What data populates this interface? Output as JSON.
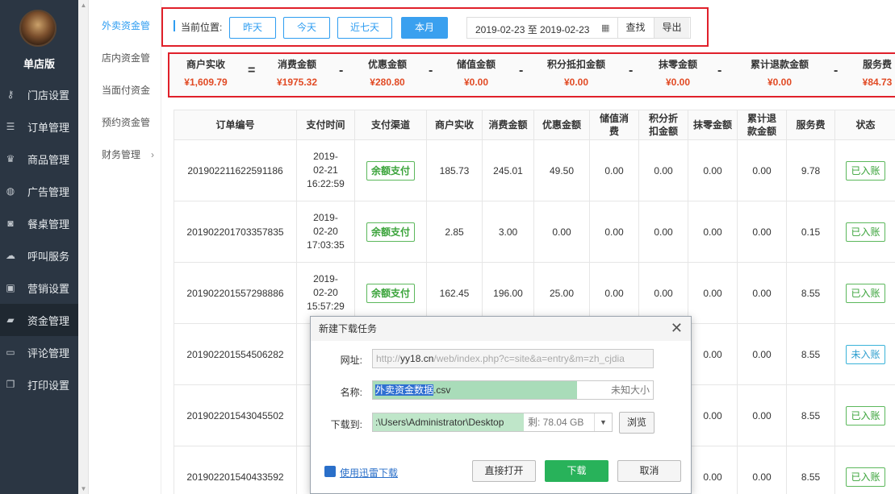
{
  "sidebar": {
    "shop_name": "单店版",
    "items": [
      {
        "label": "门店设置",
        "icon": "key-icon"
      },
      {
        "label": "订单管理",
        "icon": "list-icon"
      },
      {
        "label": "商品管理",
        "icon": "trophy-icon"
      },
      {
        "label": "广告管理",
        "icon": "globe-icon"
      },
      {
        "label": "餐桌管理",
        "icon": "binoculars-icon"
      },
      {
        "label": "呼叫服务",
        "icon": "cloud-icon"
      },
      {
        "label": "营销设置",
        "icon": "gift-icon"
      },
      {
        "label": "资金管理",
        "icon": "book-icon",
        "active": true
      },
      {
        "label": "评论管理",
        "icon": "money-icon"
      },
      {
        "label": "打印设置",
        "icon": "copy-icon"
      }
    ]
  },
  "subnav": {
    "items": [
      {
        "label": "外卖资金管",
        "active": true
      },
      {
        "label": "店内资金管"
      },
      {
        "label": "当面付资金"
      },
      {
        "label": "预约资金管"
      },
      {
        "label": "财务管理"
      }
    ],
    "chevron": "›"
  },
  "toolbar": {
    "location_label": "当前位置:",
    "buttons": [
      "昨天",
      "今天",
      "近七天",
      "本月"
    ],
    "date_range": "2019-02-23 至 2019-02-23",
    "search_label": "查找",
    "export_label": "导出"
  },
  "summary": {
    "items": [
      {
        "label": "商户实收",
        "value": "¥1,609.79"
      },
      {
        "label": "消费金额",
        "value": "¥1975.32"
      },
      {
        "label": "优惠金额",
        "value": "¥280.80"
      },
      {
        "label": "储值金额",
        "value": "¥0.00"
      },
      {
        "label": "积分抵扣金额",
        "value": "¥0.00"
      },
      {
        "label": "抹零金额",
        "value": "¥0.00"
      },
      {
        "label": "累计退款金额",
        "value": "¥0.00"
      },
      {
        "label": "服务费",
        "value": "¥84.73"
      }
    ],
    "operators": [
      "=",
      "-",
      "-",
      "-",
      "-",
      "-",
      "-"
    ]
  },
  "table": {
    "headers": [
      "订单编号",
      "支付时间",
      "支付渠道",
      "商户实收",
      "消费金额",
      "优惠金额",
      "储值消费",
      "积分折扣金额",
      "抹零金额",
      "累计退款金额",
      "服务费",
      "状态"
    ],
    "rows": [
      {
        "order": "201902211622591186",
        "time": [
          "2019-",
          "02-21",
          "16:22:59"
        ],
        "channel": "余额支付",
        "received": "185.73",
        "consume": "245.01",
        "discount": "49.50",
        "stored": "0.00",
        "points": "0.00",
        "rounding": "0.00",
        "refund": "0.00",
        "fee": "9.78",
        "status": "已入账",
        "status_color": "green"
      },
      {
        "order": "201902201703357835",
        "time": [
          "2019-",
          "02-20",
          "17:03:35"
        ],
        "channel": "余额支付",
        "received": "2.85",
        "consume": "3.00",
        "discount": "0.00",
        "stored": "0.00",
        "points": "0.00",
        "rounding": "0.00",
        "refund": "0.00",
        "fee": "0.15",
        "status": "已入账",
        "status_color": "green"
      },
      {
        "order": "201902201557298886",
        "time": [
          "2019-",
          "02-20",
          "15:57:29"
        ],
        "channel": "余额支付",
        "received": "162.45",
        "consume": "196.00",
        "discount": "25.00",
        "stored": "0.00",
        "points": "0.00",
        "rounding": "0.00",
        "refund": "0.00",
        "fee": "8.55",
        "status": "已入账",
        "status_color": "green"
      },
      {
        "order": "201902201554506282",
        "rounding": "0.00",
        "refund": "0.00",
        "fee": "8.55",
        "status": "未入账",
        "status_color": "blue"
      },
      {
        "order": "201902201543045502",
        "rounding": "0.00",
        "refund": "0.00",
        "fee": "8.55",
        "status": "已入账",
        "status_color": "green"
      },
      {
        "order": "201902201540433592",
        "rounding": "0.00",
        "refund": "0.00",
        "fee": "8.55",
        "status": "已入账",
        "status_color": "green"
      }
    ]
  },
  "dialog": {
    "title": "新建下载任务",
    "url_label": "网址:",
    "url_prefix": "http://",
    "url_host": "yy18.cn",
    "url_path": "/web/index.php?c=site&a=entry&m=zh_cjdia",
    "name_label": "名称:",
    "name_selected": "外卖资金数据",
    "name_ext": ".csv",
    "name_size": "未知大小",
    "path_label": "下载到:",
    "path_value": ":\\Users\\Administrator\\Desktop",
    "path_free": "剩: 78.04 GB",
    "browse_label": "浏览",
    "xunlei_link": "使用迅雷下载",
    "open_label": "直接打开",
    "download_label": "下载",
    "cancel_label": "取消",
    "name_progress": 0.73
  }
}
